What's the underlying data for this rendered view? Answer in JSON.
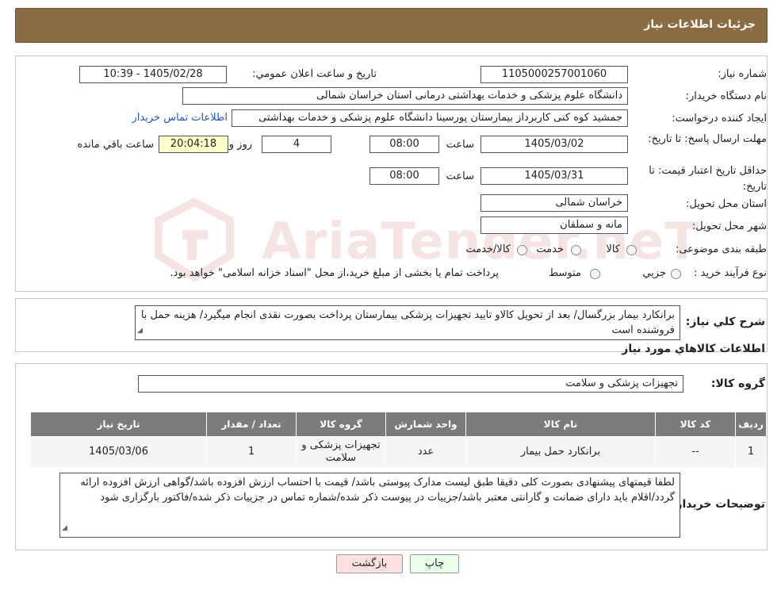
{
  "header": {
    "title": "جزئیات اطلاعات نیاز"
  },
  "form": {
    "need_number": {
      "label": "شماره نیاز:",
      "value": "1105000257001060"
    },
    "announce": {
      "label": "تاریخ و ساعت اعلان عمومي:",
      "value": "1405/02/28 - 10:39"
    },
    "buyer_org": {
      "label": "نام دستگاه خریدار:",
      "value": "دانشگاه علوم پزشکی و خدمات بهداشتی درمانی استان خراسان شمالی"
    },
    "requester": {
      "label": "ایجاد کننده درخواست:",
      "value": "جمشید کوه کنی کاربرداز بیمارستان پورسینا دانشگاه علوم پزشکی و خدمات بهداشتی",
      "contact_link": "اطلاعات تماس خریدار"
    },
    "deadline": {
      "label": "مهلت ارسال پاسخ: تا تاریخ:",
      "date": "1405/03/02",
      "time_label": "ساعت",
      "time": "08:00",
      "days": "4",
      "days_label": "روز و",
      "remaining": "20:04:18",
      "remaining_label": "ساعت باقي مانده"
    },
    "validity": {
      "label": "حداقل تاریخ اعتبار قیمت: تا تاریخ:",
      "date": "1405/03/31",
      "time_label": "ساعت",
      "time": "08:00"
    },
    "province": {
      "label": "استان محل تحویل:",
      "value": "خراسان شمالی"
    },
    "city": {
      "label": "شهر محل تحویل:",
      "value": "مانه و سملقان"
    },
    "category": {
      "label": "طبقه بندی موضوعی:",
      "options": [
        "کالا",
        "خدمت",
        "کالا/خدمت"
      ]
    },
    "purchase": {
      "label": "نوع فرآیند خرید :",
      "options": [
        "جزیي",
        "متوسط"
      ],
      "note": "پرداخت تمام یا بخشی از مبلغ خرید،از محل \"اسناد خزانه اسلامی\" خواهد بود."
    }
  },
  "description": {
    "label": "شرح کلي نیاز:",
    "text": "برانکارد بیمار بزرگسال/ بعد از تحویل کالاو تایید تجهیزات پزشکی بیمارستان پرداخت بصورت نقدی انجام میگیرد/ هزینه حمل با فروشنده است"
  },
  "goods_title": "اطلاعات کالاهاي مورد نیاز",
  "goods_group": {
    "label": "گروه کالا:",
    "value": "تجهیزات پزشکی و سلامت"
  },
  "table": {
    "headers": [
      "ردیف",
      "کد کالا",
      "نام کالا",
      "واحد شمارش",
      "گروه کالا",
      "تعداد / مقدار",
      "تاریخ نیاز"
    ],
    "rows": [
      [
        "1",
        "--",
        "برانکارد حمل بیمار",
        "عدد",
        "تجهیزات پزشکی و سلامت",
        "1",
        "1405/03/06"
      ]
    ]
  },
  "buyer_notes": {
    "label": "توضیحات خریدار:",
    "text": "لطفا قیمتهای پیشنهادی بصورت کلی  دقیقا طبق لیست مدارک پیوستی باشد/ قیمت با احتساب ارزش افزوده باشد/گواهی ارزش افزوده ارائه گردد/اقلام باید دارای ضمانت و گارانتی معتبر باشد/جزییات در پیوست ذکر شده/شماره تماس در جزییات ذکر شده/فاکتور بارگزاری شود"
  },
  "buttons": {
    "print": "چاپ",
    "back": "بازگشت"
  },
  "colors": {
    "header_bg": "#8b6b42",
    "table_header": "#7b7b7b",
    "print_bg": "#eaffea",
    "back_bg": "#ffe0e0",
    "link": "#1a56c4"
  }
}
